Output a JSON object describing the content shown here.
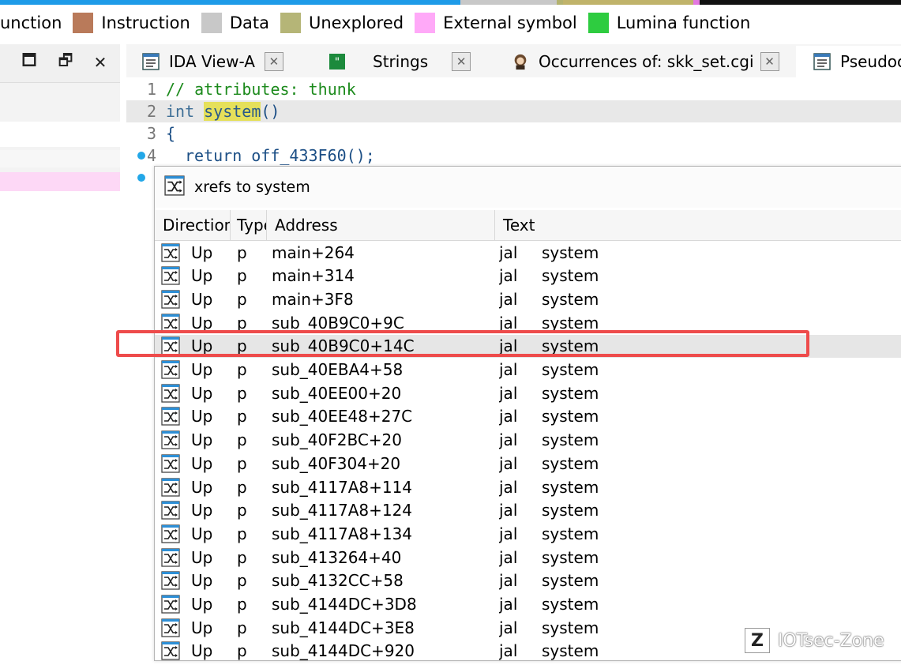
{
  "legend": [
    {
      "label": "unction",
      "color": ""
    },
    {
      "label": "Instruction",
      "color": "#b97a5a"
    },
    {
      "label": "Data",
      "color": "#c8c8c8"
    },
    {
      "label": "Unexplored",
      "color": "#b5b577"
    },
    {
      "label": "External symbol",
      "color": "#ffa9f8"
    },
    {
      "label": "Lumina function",
      "color": "#2ecc40"
    }
  ],
  "window_controls": {
    "maximize": "🗖",
    "restore": "🗗",
    "close": "✕"
  },
  "tabs": [
    {
      "label": "IDA View-A",
      "close": "✕"
    },
    {
      "label": "Strings",
      "close": "✕"
    },
    {
      "label": "Occurrences of: skk_set.cgi",
      "close": "✕"
    },
    {
      "label": "Pseudoc"
    }
  ],
  "code": {
    "lines": [
      {
        "num": "1",
        "comment": "// attributes: thunk"
      },
      {
        "num": "2",
        "type": "int",
        "name": "system",
        "rest": "()"
      },
      {
        "num": "3",
        "text": "{"
      },
      {
        "num": "4",
        "kw": "return",
        "name": "off_433F60",
        "rest": "();"
      }
    ]
  },
  "xrefs": {
    "title": "xrefs to system",
    "columns": [
      "Direction",
      "Type",
      "Address",
      "Text"
    ],
    "rows": [
      {
        "dir": "Up",
        "type": "p",
        "addr": "main+264",
        "op": "jal",
        "target": "system"
      },
      {
        "dir": "Up",
        "type": "p",
        "addr": "main+314",
        "op": "jal",
        "target": "system"
      },
      {
        "dir": "Up",
        "type": "p",
        "addr": "main+3F8",
        "op": "jal",
        "target": "system"
      },
      {
        "dir": "Up",
        "type": "p",
        "addr": "sub_40B9C0+9C",
        "op": "jal",
        "target": "system"
      },
      {
        "dir": "Up",
        "type": "p",
        "addr": "sub_40B9C0+14C",
        "op": "jal",
        "target": "system"
      },
      {
        "dir": "Up",
        "type": "p",
        "addr": "sub_40EBA4+58",
        "op": "jal",
        "target": "system"
      },
      {
        "dir": "Up",
        "type": "p",
        "addr": "sub_40EE00+20",
        "op": "jal",
        "target": "system"
      },
      {
        "dir": "Up",
        "type": "p",
        "addr": "sub_40EE48+27C",
        "op": "jal",
        "target": "system"
      },
      {
        "dir": "Up",
        "type": "p",
        "addr": "sub_40F2BC+20",
        "op": "jal",
        "target": "system"
      },
      {
        "dir": "Up",
        "type": "p",
        "addr": "sub_40F304+20",
        "op": "jal",
        "target": "system"
      },
      {
        "dir": "Up",
        "type": "p",
        "addr": "sub_4117A8+114",
        "op": "jal",
        "target": "system"
      },
      {
        "dir": "Up",
        "type": "p",
        "addr": "sub_4117A8+124",
        "op": "jal",
        "target": "system"
      },
      {
        "dir": "Up",
        "type": "p",
        "addr": "sub_4117A8+134",
        "op": "jal",
        "target": "system"
      },
      {
        "dir": "Up",
        "type": "p",
        "addr": "sub_413264+40",
        "op": "jal",
        "target": "system"
      },
      {
        "dir": "Up",
        "type": "p",
        "addr": "sub_4132CC+58",
        "op": "jal",
        "target": "system"
      },
      {
        "dir": "Up",
        "type": "p",
        "addr": "sub_4144DC+3D8",
        "op": "jal",
        "target": "system"
      },
      {
        "dir": "Up",
        "type": "p",
        "addr": "sub_4144DC+3E8",
        "op": "jal",
        "target": "system"
      },
      {
        "dir": "Up",
        "type": "p",
        "addr": "sub_4144DC+920",
        "op": "jal",
        "target": "system"
      }
    ],
    "selected_index": 4
  },
  "watermark": {
    "text": "IOTsec-Zone",
    "logo": "Z"
  },
  "colors": {
    "accent": "#1e9be8",
    "highlight_box": "#ee4b4b",
    "comment": "#1c8a1c",
    "func_hl": "#e5e05a"
  }
}
